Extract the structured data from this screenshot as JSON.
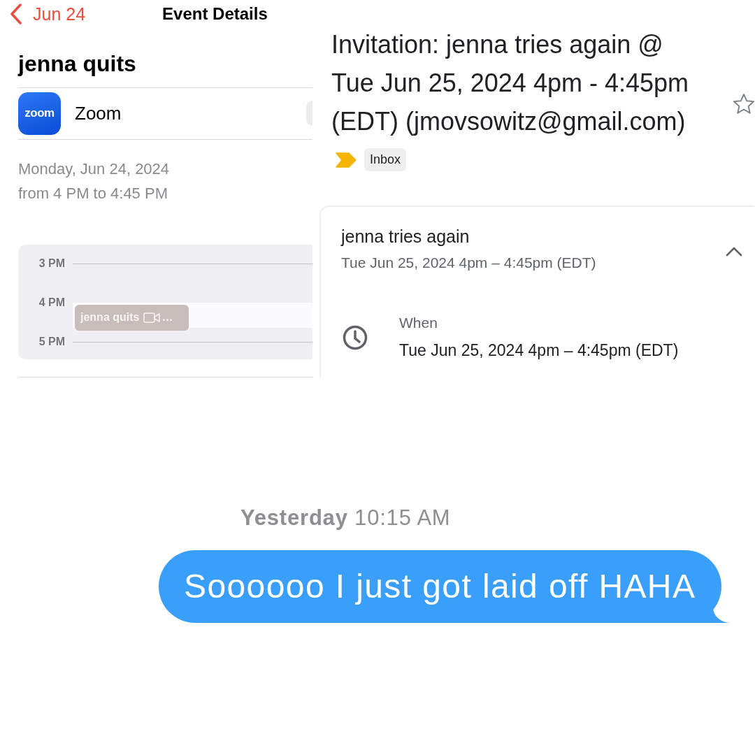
{
  "calendar_event": {
    "nav": {
      "back_label": "Jun 24",
      "title": "Event Details"
    },
    "title": "jenna quits",
    "location": {
      "logo_text": "zoom",
      "name": "Zoom"
    },
    "date": "Monday, Jun 24, 2024",
    "time_range": "from 4 PM to 4:45 PM",
    "day_preview": {
      "hours": [
        {
          "label": "3 PM"
        },
        {
          "label": "4 PM",
          "event": {
            "title": "jenna quits",
            "video_call": true,
            "overflow": "…"
          }
        },
        {
          "label": "5 PM"
        }
      ]
    }
  },
  "email": {
    "subject": "Invitation: jenna tries again @ Tue Jun 25, 2024 4pm - 4:45pm (EDT) (jmovsowitz@gmail.com)",
    "starred": false,
    "important": true,
    "label": "Inbox",
    "event_card": {
      "title": "jenna tries again",
      "subtitle": "Tue Jun 25, 2024 4pm – 4:45pm (EDT)",
      "expanded": true,
      "details": [
        {
          "kind": "time",
          "label": "When",
          "value": "Tue Jun 25, 2024 4pm – 4:45pm (EDT)"
        }
      ]
    }
  },
  "message": {
    "timestamp": "**Yesterday** 10:15 AM",
    "text": "Soooooo I just got laid off HAHA"
  }
}
